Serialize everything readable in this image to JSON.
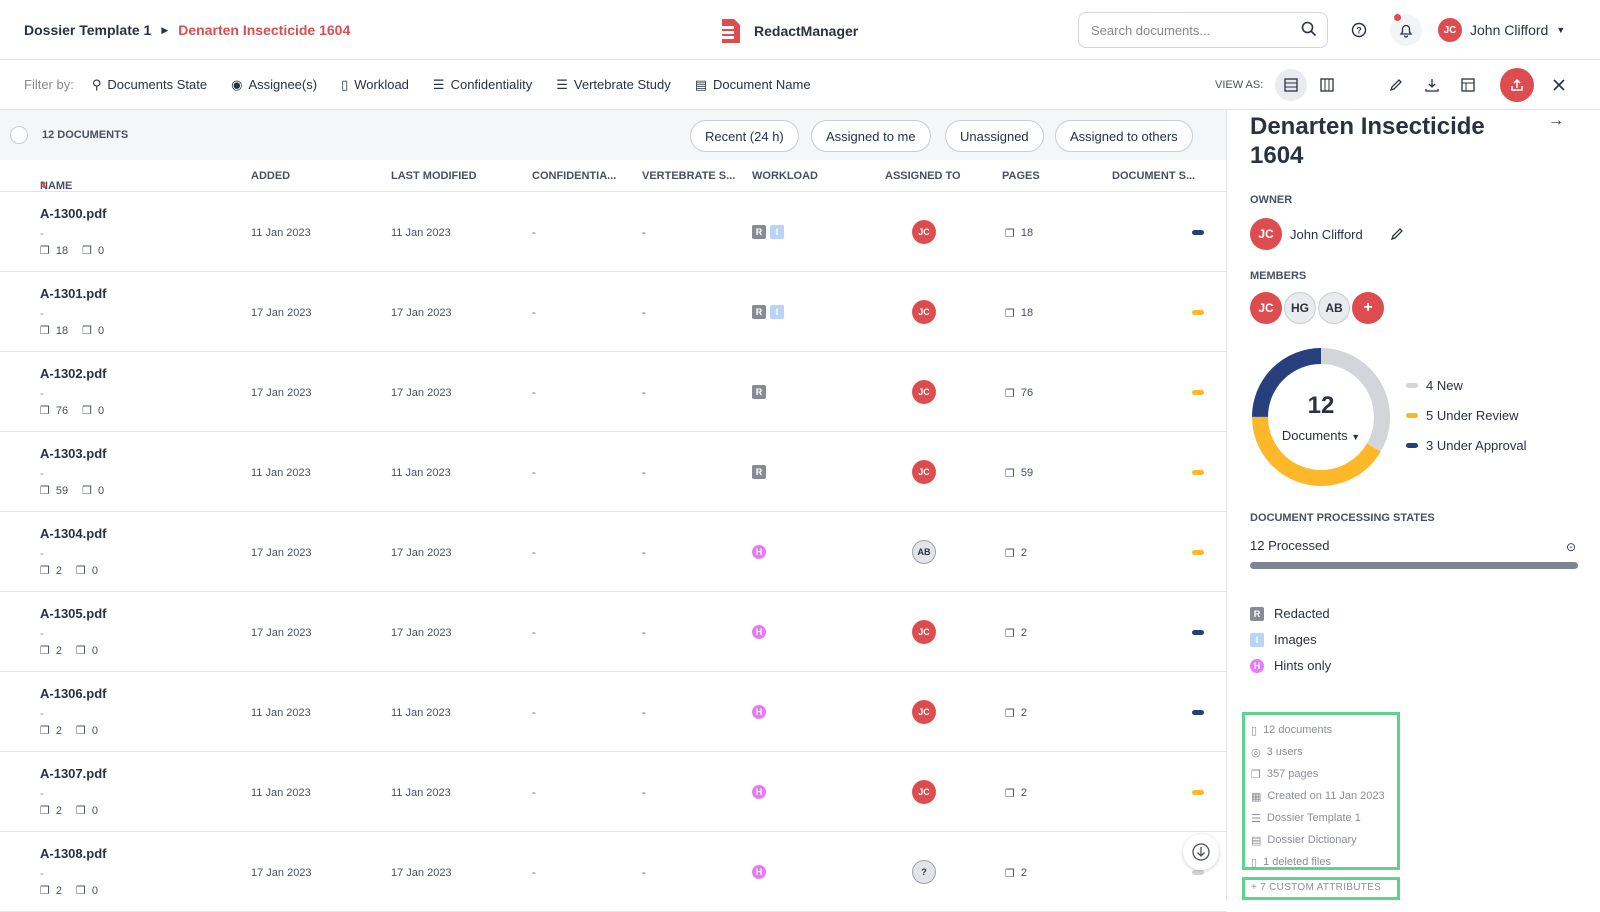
{
  "header": {
    "breadcrumb_parent": "Dossier Template 1",
    "breadcrumb_current": "Denarten Insecticide 1604",
    "app_name": "RedactManager",
    "search_placeholder": "Search documents...",
    "user_initials": "JC",
    "user_name": "John Clifford"
  },
  "filters": {
    "label": "Filter by:",
    "items": [
      "Documents State",
      "Assignee(s)",
      "Workload",
      "Confidentiality",
      "Vertebrate Study",
      "Document Name"
    ],
    "view_as": "VIEW AS:"
  },
  "list": {
    "count_label": "12 DOCUMENTS",
    "quick_filters": [
      "Recent (24 h)",
      "Assigned to me",
      "Unassigned",
      "Assigned to others"
    ],
    "columns": [
      "NAME",
      "ADDED",
      "LAST MODIFIED",
      "CONFIDENTIA...",
      "VERTEBRATE S...",
      "WORKLOAD",
      "ASSIGNED TO",
      "PAGES",
      "DOCUMENT S..."
    ],
    "rows": [
      {
        "name": "A-1300.pdf",
        "sub": "-",
        "pages_meta": "18",
        "annotations": "0",
        "added": "11 Jan 2023",
        "modified": "11 Jan 2023",
        "conf": "-",
        "vert": "-",
        "workload": [
          "R",
          "I"
        ],
        "assignee": "JC",
        "pages": "18",
        "status": "#283f7d"
      },
      {
        "name": "A-1301.pdf",
        "sub": "-",
        "pages_meta": "18",
        "annotations": "0",
        "added": "17 Jan 2023",
        "modified": "17 Jan 2023",
        "conf": "-",
        "vert": "-",
        "workload": [
          "R",
          "I"
        ],
        "assignee": "JC",
        "pages": "18",
        "status": "#fcb829"
      },
      {
        "name": "A-1302.pdf",
        "sub": "-",
        "pages_meta": "76",
        "annotations": "0",
        "added": "17 Jan 2023",
        "modified": "17 Jan 2023",
        "conf": "-",
        "vert": "-",
        "workload": [
          "R"
        ],
        "assignee": "JC",
        "pages": "76",
        "status": "#fcb829"
      },
      {
        "name": "A-1303.pdf",
        "sub": "-",
        "pages_meta": "59",
        "annotations": "0",
        "added": "11 Jan 2023",
        "modified": "11 Jan 2023",
        "conf": "-",
        "vert": "-",
        "workload": [
          "R"
        ],
        "assignee": "JC",
        "pages": "59",
        "status": "#fcb829"
      },
      {
        "name": "A-1304.pdf",
        "sub": "-",
        "pages_meta": "2",
        "annotations": "0",
        "added": "17 Jan 2023",
        "modified": "17 Jan 2023",
        "conf": "-",
        "vert": "-",
        "workload": [
          "H"
        ],
        "assignee": "AB",
        "pages": "2",
        "status": "#fcb829"
      },
      {
        "name": "A-1305.pdf",
        "sub": "-",
        "pages_meta": "2",
        "annotations": "0",
        "added": "17 Jan 2023",
        "modified": "17 Jan 2023",
        "conf": "-",
        "vert": "-",
        "workload": [
          "H"
        ],
        "assignee": "JC",
        "pages": "2",
        "status": "#283f7d"
      },
      {
        "name": "A-1306.pdf",
        "sub": "-",
        "pages_meta": "2",
        "annotations": "0",
        "added": "11 Jan 2023",
        "modified": "11 Jan 2023",
        "conf": "-",
        "vert": "-",
        "workload": [
          "H"
        ],
        "assignee": "JC",
        "pages": "2",
        "status": "#283f7d"
      },
      {
        "name": "A-1307.pdf",
        "sub": "-",
        "pages_meta": "2",
        "annotations": "0",
        "added": "11 Jan 2023",
        "modified": "11 Jan 2023",
        "conf": "-",
        "vert": "-",
        "workload": [
          "H"
        ],
        "assignee": "JC",
        "pages": "2",
        "status": "#fcb829"
      },
      {
        "name": "A-1308.pdf",
        "sub": "-",
        "pages_meta": "2",
        "annotations": "0",
        "added": "17 Jan 2023",
        "modified": "17 Jan 2023",
        "conf": "-",
        "vert": "-",
        "workload": [
          "H"
        ],
        "assignee": "?",
        "pages": "2",
        "status": "#d3d5da"
      }
    ]
  },
  "panel": {
    "title": "Denarten Insecticide 1604",
    "owner_label": "OWNER",
    "owner_initials": "JC",
    "owner_name": "John Clifford",
    "members_label": "MEMBERS",
    "members": [
      "JC",
      "HG",
      "AB"
    ],
    "add_member": "+",
    "donut_total": "12",
    "donut_label": "Documents",
    "legend": [
      {
        "label": "4 New",
        "value": 4,
        "color": "#d3d5da"
      },
      {
        "label": "5 Under Review",
        "value": 5,
        "color": "#fcb829"
      },
      {
        "label": "3 Under Approval",
        "value": 3,
        "color": "#283f7d"
      }
    ],
    "processing_label": "DOCUMENT PROCESSING STATES",
    "processed": "12 Processed",
    "processed_fraction": 1.0,
    "workload_legend": [
      {
        "badge": "R",
        "label": "Redacted"
      },
      {
        "badge": "I",
        "label": "Images"
      },
      {
        "badge": "H",
        "label": "Hints only"
      }
    ],
    "stats": [
      "12 documents",
      "3 users",
      "357 pages",
      "Created on 11 Jan 2023",
      "Dossier Template 1",
      "Dossier Dictionary",
      "1 deleted files"
    ],
    "custom_attributes": "+ 7 CUSTOM ATTRIBUTES"
  }
}
